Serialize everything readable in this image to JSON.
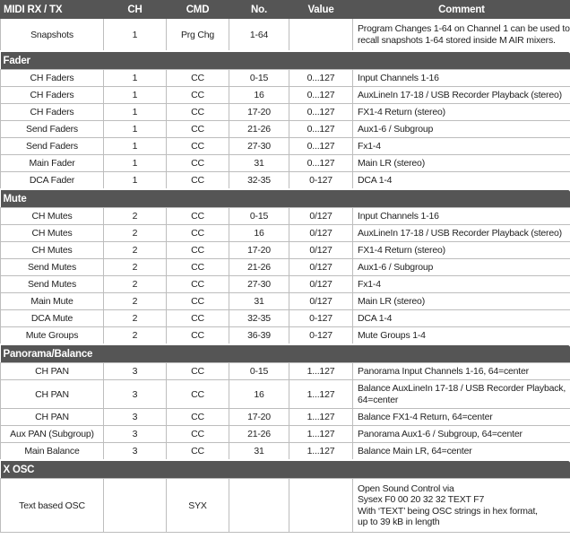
{
  "headers": [
    "MIDI RX / TX",
    "CH",
    "CMD",
    "No.",
    "Value",
    "Comment"
  ],
  "rows": [
    {
      "cells": [
        "Snapshots",
        "1",
        "Prg Chg",
        "1-64",
        "",
        "Program Changes 1-64 on Channel 1 can be used to recall snapshots 1-64 stored inside M AIR mixers."
      ],
      "h": 36
    },
    {
      "section": "Fader"
    },
    {
      "cells": [
        "CH Faders",
        "1",
        "CC",
        "0-15",
        "0...127",
        "Input Channels 1-16"
      ],
      "h": 19
    },
    {
      "cells": [
        "CH Faders",
        "1",
        "CC",
        "16",
        "0...127",
        "AuxLineIn 17-18 / USB Recorder Playback (stereo)"
      ],
      "h": 19
    },
    {
      "cells": [
        "CH Faders",
        "1",
        "CC",
        "17-20",
        "0...127",
        "FX1-4 Return (stereo)"
      ],
      "h": 19
    },
    {
      "cells": [
        "Send Faders",
        "1",
        "CC",
        "21-26",
        "0...127",
        "Aux1-6 / Subgroup"
      ],
      "h": 19
    },
    {
      "cells": [
        "Send Faders",
        "1",
        "CC",
        "27-30",
        "0...127",
        "Fx1-4"
      ],
      "h": 19
    },
    {
      "cells": [
        "Main Fader",
        "1",
        "CC",
        "31",
        "0...127",
        "Main LR (stereo)"
      ],
      "h": 19
    },
    {
      "cells": [
        "DCA Fader",
        "1",
        "CC",
        "32-35",
        "0-127",
        "DCA 1-4"
      ],
      "h": 19
    },
    {
      "section": "Mute"
    },
    {
      "cells": [
        "CH Mutes",
        "2",
        "CC",
        "0-15",
        "0/127",
        "Input Channels 1-16"
      ],
      "h": 19
    },
    {
      "cells": [
        "CH Mutes",
        "2",
        "CC",
        "16",
        "0/127",
        "AuxLineIn 17-18 / USB Recorder Playback (stereo)"
      ],
      "h": 19
    },
    {
      "cells": [
        "CH Mutes",
        "2",
        "CC",
        "17-20",
        "0/127",
        "FX1-4 Return (stereo)"
      ],
      "h": 19
    },
    {
      "cells": [
        "Send Mutes",
        "2",
        "CC",
        "21-26",
        "0/127",
        "Aux1-6 / Subgroup"
      ],
      "h": 19
    },
    {
      "cells": [
        "Send Mutes",
        "2",
        "CC",
        "27-30",
        "0/127",
        "Fx1-4"
      ],
      "h": 19
    },
    {
      "cells": [
        "Main Mute",
        "2",
        "CC",
        "31",
        "0/127",
        "Main LR (stereo)"
      ],
      "h": 19
    },
    {
      "cells": [
        "DCA Mute",
        "2",
        "CC",
        "32-35",
        "0-127",
        "DCA 1-4"
      ],
      "h": 19
    },
    {
      "cells": [
        "Mute Groups",
        "2",
        "CC",
        "36-39",
        "0-127",
        "Mute Groups 1-4"
      ],
      "h": 19
    },
    {
      "section": "Panorama/Balance"
    },
    {
      "cells": [
        "CH PAN",
        "3",
        "CC",
        "0-15",
        "1...127",
        "Panorama Input Channels 1-16, 64=center"
      ],
      "h": 19
    },
    {
      "cells": [
        "CH PAN",
        "3",
        "CC",
        "16",
        "1...127",
        "Balance AuxLineIn 17-18 / USB Recorder Playback, 64=center"
      ],
      "h": 32
    },
    {
      "cells": [
        "CH PAN",
        "3",
        "CC",
        "17-20",
        "1...127",
        "Balance FX1-4 Return, 64=center"
      ],
      "h": 19
    },
    {
      "cells": [
        "Aux PAN (Subgroup)",
        "3",
        "CC",
        "21-26",
        "1...127",
        "Panorama Aux1-6 / Subgroup, 64=center"
      ],
      "h": 19
    },
    {
      "cells": [
        "Main Balance",
        "3",
        "CC",
        "31",
        "1...127",
        "Balance Main LR, 64=center"
      ],
      "h": 19
    },
    {
      "section": "X OSC"
    },
    {
      "cells": [
        "Text based OSC",
        "",
        "SYX",
        "",
        "",
        "Open Sound Control via\nSysex F0 00 20 32 32 TEXT F7\nWith ‘TEXT’ being OSC strings in hex format,\nup to 39 kB in length"
      ],
      "h": 60
    }
  ]
}
